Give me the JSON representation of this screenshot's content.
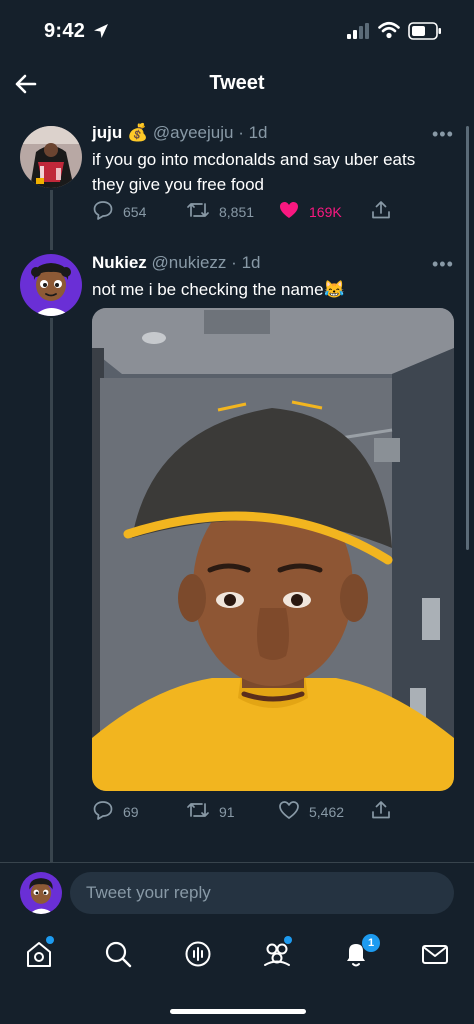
{
  "status_bar": {
    "time": "9:42"
  },
  "header": {
    "title": "Tweet"
  },
  "tweets": [
    {
      "name": "juju",
      "emoji": "💰",
      "handle": "@ayeejuju",
      "time": "1d",
      "text_lines": [
        "if you go into mcdonalds and say uber eats",
        "they give you free food"
      ],
      "replies": "654",
      "retweets": "8,851",
      "likes": "169K",
      "liked": true
    },
    {
      "name": "Nukiez",
      "handle": "@nukiezz",
      "time": "1d",
      "text": "not me i be checking the name😹",
      "replies": "69",
      "retweets": "91",
      "likes": "5,462",
      "liked": false
    }
  ],
  "more_label": "•••",
  "reply": {
    "placeholder": "Tweet your reply"
  },
  "bottom_nav": {
    "items": [
      "home-icon",
      "search-icon",
      "spaces-icon",
      "communities-icon",
      "notifications-icon",
      "messages-icon"
    ],
    "notification_count": "1"
  },
  "colors": {
    "background": "#15202b",
    "text_secondary": "#8899a6",
    "like_pink": "#f91880",
    "accent_blue": "#1d9bf0",
    "divider": "#38444d"
  }
}
